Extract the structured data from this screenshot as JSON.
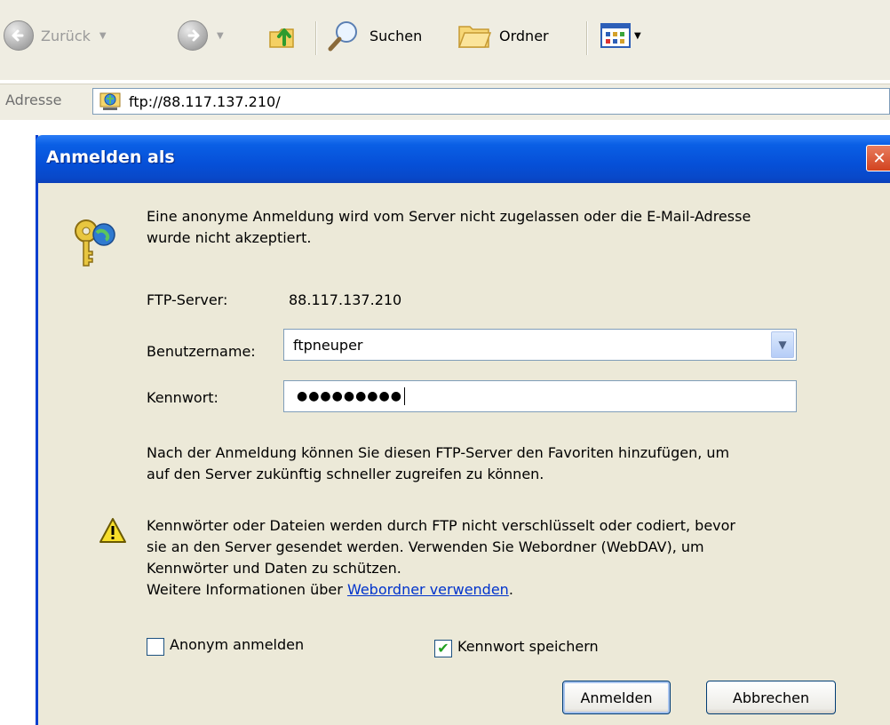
{
  "toolbar": {
    "back_label": "Zurück",
    "search_label": "Suchen",
    "folders_label": "Ordner",
    "address_label": "Adresse",
    "address_value": "ftp://88.117.137.210/"
  },
  "icons": {
    "back": "back-arrow-icon",
    "forward": "forward-arrow-icon",
    "up": "folder-up-icon",
    "search": "search-magnifier-icon",
    "folders": "folder-icon",
    "views": "views-icon",
    "ftp": "ftp-folder-icon",
    "keys": "keys-icon",
    "warning": "warning-icon"
  },
  "dialog": {
    "title": "Anmelden als",
    "close_glyph": "✕",
    "message_line1": "Eine anonyme Anmeldung wird vom Server nicht zugelassen oder die E-Mail-Adresse",
    "message_line2": "wurde nicht akzeptiert.",
    "server_label": "FTP-Server:",
    "server_value": "88.117.137.210",
    "username_label": "Benutzername:",
    "username_value": "ftpneuper",
    "password_label": "Kennwort:",
    "password_value": "●●●●●●●●●",
    "info_line1": "Nach der Anmeldung können Sie diesen FTP-Server den Favoriten hinzufügen, um",
    "info_line2": "auf den Server zukünftig schneller zugreifen zu können.",
    "warning_line1": "Kennwörter oder Dateien werden durch FTP nicht verschlüsselt oder codiert, bevor",
    "warning_line2": "sie an den Server gesendet werden. Verwenden Sie Webordner (WebDAV), um",
    "warning_line3": "Kennwörter und Daten zu schützen.",
    "more_info_prefix": "Weitere Informationen über ",
    "more_info_link": "Webordner verwenden",
    "more_info_suffix": ".",
    "anonymous_label": "Anonym anmelden",
    "anonymous_checked": false,
    "save_password_label": "Kennwort speichern",
    "save_password_checked": true,
    "check_glyph": "✔",
    "login_button": "Anmelden",
    "cancel_button": "Abbrechen"
  },
  "colors": {
    "titlebar": "#0650d8",
    "dialog_bg": "#ece9d8",
    "link": "#0033cc",
    "check": "#21a121"
  }
}
